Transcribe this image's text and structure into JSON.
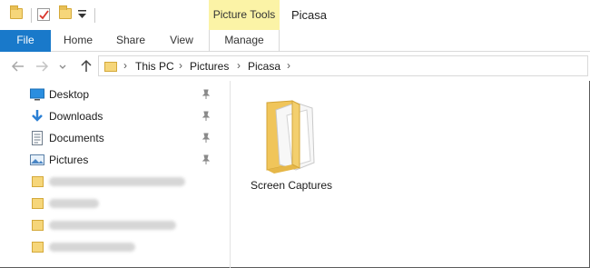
{
  "quick_access": {
    "icons": [
      "folder-icon",
      "properties-icon",
      "new-folder-icon",
      "customize-dropdown-icon"
    ]
  },
  "ribbon": {
    "contextual_group": "Picture Tools",
    "window_title": "Picasa",
    "tabs": [
      {
        "label": "File"
      },
      {
        "label": "Home"
      },
      {
        "label": "Share"
      },
      {
        "label": "View"
      },
      {
        "label": "Manage"
      }
    ]
  },
  "address_bar": {
    "crumbs": [
      "This PC",
      "Pictures",
      "Picasa"
    ]
  },
  "navigation_pane": {
    "items": [
      {
        "label": "Desktop",
        "icon": "desktop-icon",
        "pinned": true
      },
      {
        "label": "Downloads",
        "icon": "downloads-icon",
        "pinned": true
      },
      {
        "label": "Documents",
        "icon": "documents-icon",
        "pinned": true
      },
      {
        "label": "Pictures",
        "icon": "pictures-icon",
        "pinned": true
      }
    ],
    "blurred_folders": 4
  },
  "content": {
    "items": [
      {
        "name": "Screen Captures",
        "type": "folder"
      }
    ]
  },
  "colors": {
    "file_tab": "#1979ca",
    "contextual_tab": "#fbf3a6",
    "folder": "#f6d67a"
  }
}
